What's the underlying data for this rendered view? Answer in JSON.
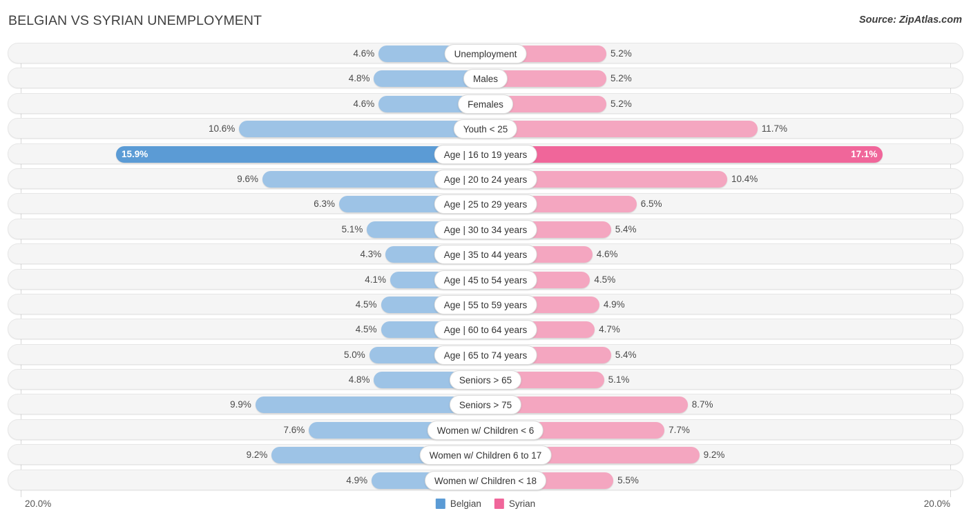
{
  "header": {
    "title": "BELGIAN VS SYRIAN UNEMPLOYMENT",
    "source": "Source: ZipAtlas.com"
  },
  "footer": {
    "axis_left": "20.0%",
    "axis_right": "20.0%",
    "legend": [
      {
        "label": "Belgian",
        "color": "#5b9bd5"
      },
      {
        "label": "Syrian",
        "color": "#f0669a"
      }
    ]
  },
  "colors": {
    "left_bar": "#9dc3e6",
    "right_bar": "#f4a6c0",
    "left_bar_max": "#5b9bd5",
    "right_bar_max": "#f0669a",
    "track": "#f5f5f5",
    "gridline": "#d8d8d8"
  },
  "chart_data": {
    "type": "bar",
    "subtype": "diverging-bar",
    "title": "BELGIAN VS SYRIAN UNEMPLOYMENT",
    "xlabel": "",
    "ylabel": "",
    "axis_max": 20.0,
    "unit": "%",
    "grid": true,
    "legend_position": "bottom-center",
    "categories": [
      "Unemployment",
      "Males",
      "Females",
      "Youth < 25",
      "Age | 16 to 19 years",
      "Age | 20 to 24 years",
      "Age | 25 to 29 years",
      "Age | 30 to 34 years",
      "Age | 35 to 44 years",
      "Age | 45 to 54 years",
      "Age | 55 to 59 years",
      "Age | 60 to 64 years",
      "Age | 65 to 74 years",
      "Seniors > 65",
      "Seniors > 75",
      "Women w/ Children < 6",
      "Women w/ Children 6 to 17",
      "Women w/ Children < 18"
    ],
    "series": [
      {
        "name": "Belgian",
        "side": "left",
        "color": "#9dc3e6",
        "values": [
          4.6,
          4.8,
          4.6,
          10.6,
          15.9,
          9.6,
          6.3,
          5.1,
          4.3,
          4.1,
          4.5,
          4.5,
          5.0,
          4.8,
          9.9,
          7.6,
          9.2,
          4.9
        ],
        "labels": [
          "4.6%",
          "4.8%",
          "4.6%",
          "10.6%",
          "15.9%",
          "9.6%",
          "6.3%",
          "5.1%",
          "4.3%",
          "4.1%",
          "4.5%",
          "4.5%",
          "5.0%",
          "4.8%",
          "9.9%",
          "7.6%",
          "9.2%",
          "4.9%"
        ]
      },
      {
        "name": "Syrian",
        "side": "right",
        "color": "#f4a6c0",
        "values": [
          5.2,
          5.2,
          5.2,
          11.7,
          17.1,
          10.4,
          6.5,
          5.4,
          4.6,
          4.5,
          4.9,
          4.7,
          5.4,
          5.1,
          8.7,
          7.7,
          9.2,
          5.5
        ],
        "labels": [
          "5.2%",
          "5.2%",
          "5.2%",
          "11.7%",
          "17.1%",
          "10.4%",
          "6.5%",
          "5.4%",
          "4.6%",
          "4.5%",
          "4.9%",
          "4.7%",
          "5.4%",
          "5.1%",
          "8.7%",
          "7.7%",
          "9.2%",
          "5.5%"
        ]
      }
    ],
    "highlighted_row_index": 4
  }
}
